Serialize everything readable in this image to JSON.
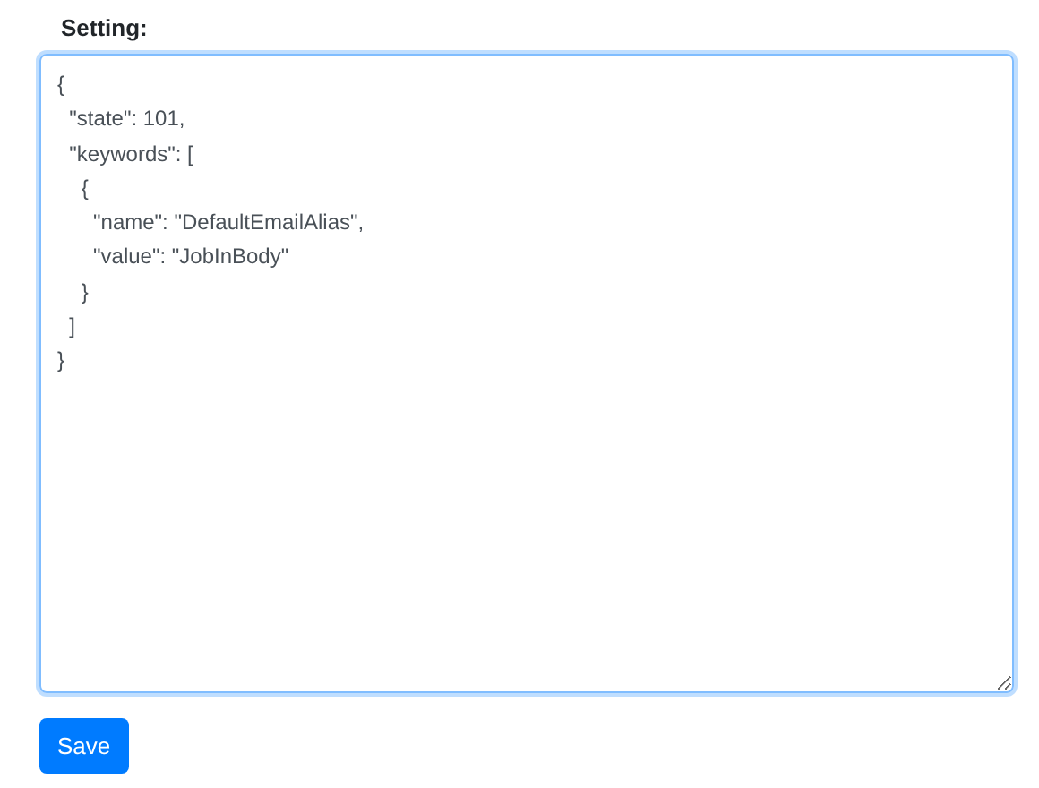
{
  "setting": {
    "label": "Setting:",
    "value": "{\n  \"state\": 101,\n  \"keywords\": [\n    {\n      \"name\": \"DefaultEmailAlias\",\n      \"value\": \"JobInBody\"\n    }\n  ]\n}"
  },
  "buttons": [
    {
      "label": "Save"
    }
  ]
}
